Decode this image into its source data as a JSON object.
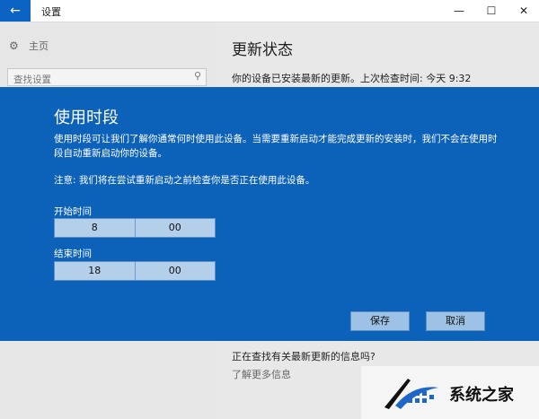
{
  "window": {
    "title": "设置",
    "back_icon": "←",
    "minimize_icon": "—",
    "maximize_icon": "☐",
    "close_icon": "✕"
  },
  "sidebar": {
    "home_label": "主页",
    "search_placeholder": "查找设置"
  },
  "main": {
    "title": "更新状态",
    "status_text": "你的设备已安装最新的更新。上次检查时间: 今天 9:32",
    "more_question": "正在查找有关最新更新的信息吗?",
    "more_link": "了解更多信息"
  },
  "dialog": {
    "title": "使用时段",
    "description": "使用时段可让我们了解你通常何时使用此设备。当需要重新启动才能完成更新的安装时，我们不会在使用时段自动重新启动你的设备。",
    "note": "注意: 我们将在尝试重新启动之前检查你是否正在使用此设备。",
    "start_label": "开始时间",
    "start_hour": "8",
    "start_minute": "00",
    "end_label": "结束时间",
    "end_hour": "18",
    "end_minute": "00",
    "save_label": "保存",
    "cancel_label": "取消"
  },
  "watermark": {
    "text": "系统之家"
  },
  "colors": {
    "accent": "#0b63c4",
    "dialog_bg": "#0c61b9",
    "button_bg": "#9ec2e6"
  }
}
